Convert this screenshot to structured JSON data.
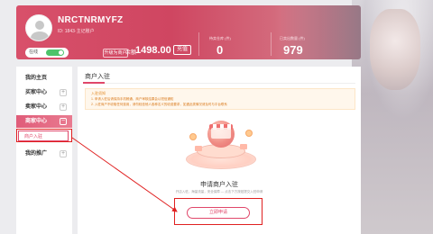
{
  "header": {
    "username": "NRCTNRMYFZ",
    "user_id_line": "ID: 1843·主记账户",
    "login_label": "在线",
    "upgrade_label": "升级为商户",
    "balance_unit": "余额",
    "balance": "1498.00",
    "recharge_label": "充值",
    "stats": [
      {
        "label": "待卖仓库 (件)",
        "value": "0"
      },
      {
        "label": "已卖出数量 (件)",
        "value": "979"
      }
    ]
  },
  "sidebar": {
    "items": [
      {
        "label": "我的主页"
      },
      {
        "label": "买家中心"
      },
      {
        "label": "卖家中心"
      },
      {
        "label": "商家中心"
      },
      {
        "label": "我的推广"
      }
    ],
    "sub_item": "商户入驻"
  },
  "main": {
    "title": "商户入驻",
    "notice_title": "入驻须知",
    "notice_lines": [
      "1. 申请入驻后请保持手机畅通，商户审核结果会以短信通知",
      "2. 入驻商户不收取任何费用，请勿轻信他人各种名义的收费要求，如遇此类情况请及时与平台联系"
    ],
    "apply_title": "申请商户入驻",
    "apply_desc": "开店入驻，海量流量，安全保障 — 点击下方按钮提交入驻申请",
    "apply_button": "立即申请"
  },
  "colors": {
    "accent": "#e0476a",
    "annotation": "#e02020"
  }
}
